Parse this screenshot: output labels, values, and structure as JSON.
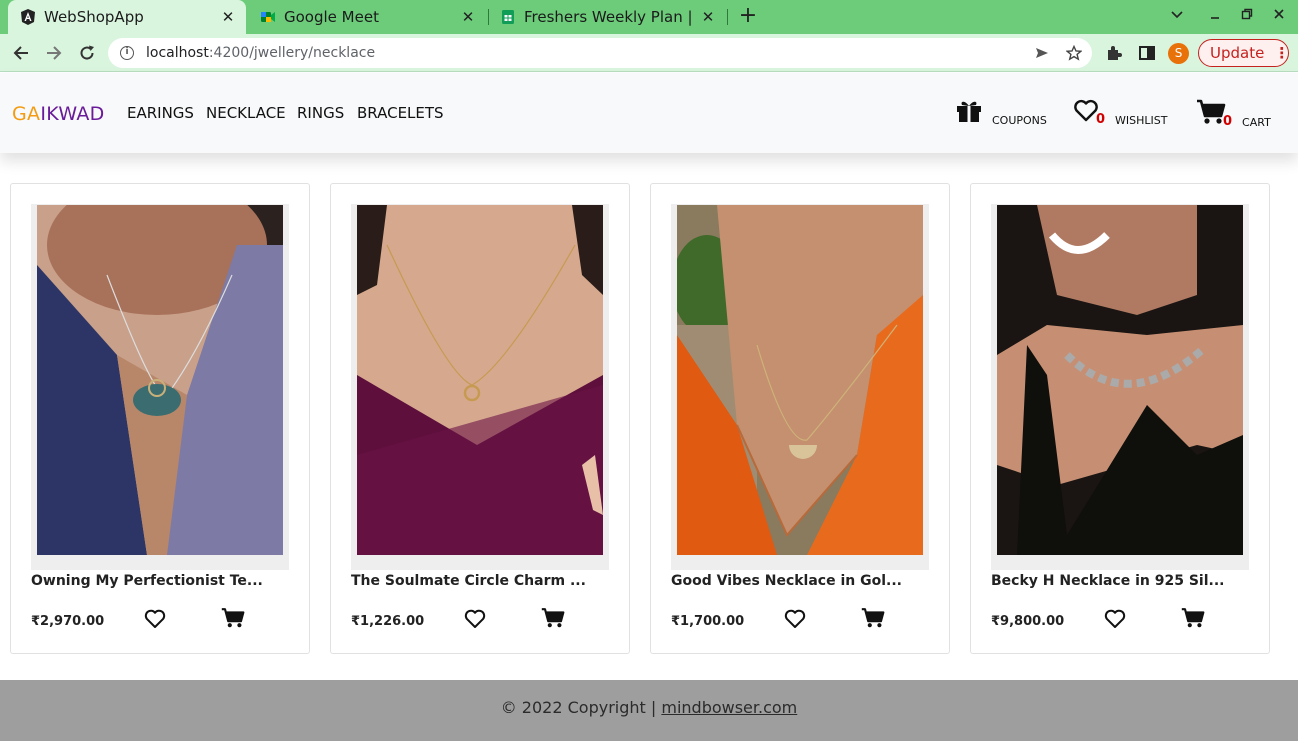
{
  "browser": {
    "tabs": [
      {
        "title": "WebShopApp",
        "icon": "angular-icon"
      },
      {
        "title": "Google Meet",
        "icon": "google-meet-icon"
      },
      {
        "title": "Freshers Weekly Plan | Sha",
        "icon": "google-sheets-icon"
      }
    ],
    "close_glyph": "✕",
    "new_tab_glyph": "+",
    "url_host": "localhost",
    "url_path": ":4200/jwellery/necklace",
    "profile_initial": "S",
    "update_label": "Update",
    "menu_glyph": "⋮"
  },
  "header": {
    "brand_ga": "GA",
    "brand_rest": "IKWAD",
    "nav": [
      "EARINGS",
      "NECKLACE",
      "RINGS",
      "BRACELETS"
    ],
    "coupons_label": "COUPONS",
    "wishlist_label": "WISHLIST",
    "wishlist_count": "0",
    "cart_label": "CART",
    "cart_count": "0"
  },
  "products": [
    {
      "name": "Owning My Perfectionist Te...",
      "price": "₹2,970.00"
    },
    {
      "name": "The Soulmate Circle Charm ...",
      "price": "₹1,226.00"
    },
    {
      "name": "Good Vibes Necklace in Gol...",
      "price": "₹1,700.00"
    },
    {
      "name": "Becky H Necklace in 925 Sil...",
      "price": "₹9,800.00"
    }
  ],
  "footer": {
    "text": "© 2022 Copyright | ",
    "link": "mindbowser.com"
  },
  "colors": {
    "tabstrip": "#6ccc7a",
    "toolbar": "#d9f5de",
    "brand_orange": "#f39c12",
    "brand_purple": "#6a1b9a",
    "count_red": "#d10000",
    "footer_bg": "#9e9e9e"
  }
}
